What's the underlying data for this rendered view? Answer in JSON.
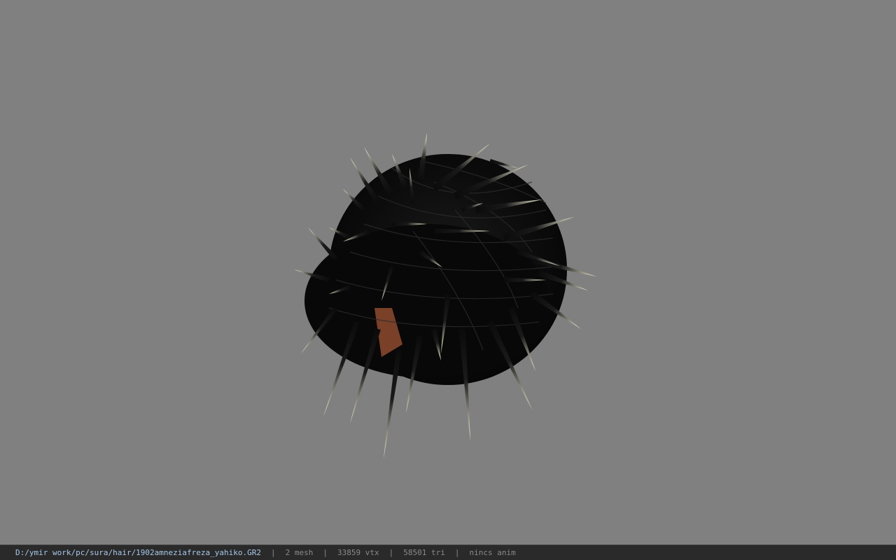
{
  "viewer": {
    "file_path": "D:/ymir work/pc/sura/hair/1902amneziafreza_yahiko.GR2",
    "mesh_count": "2 mesh",
    "vertex_count": "33859 vtx",
    "triangle_count": "58501 tri",
    "anim_status": "nincs anim",
    "separator": "|"
  },
  "colors": {
    "background": "#808080",
    "status_bar": "#2a2a2a",
    "path_text": "#a6c8e8",
    "stat_text": "#8a8a8a",
    "hair_dark": "#0b0b0b",
    "hair_tip": "#e8e6cc",
    "skin": "#8a4a2e"
  }
}
